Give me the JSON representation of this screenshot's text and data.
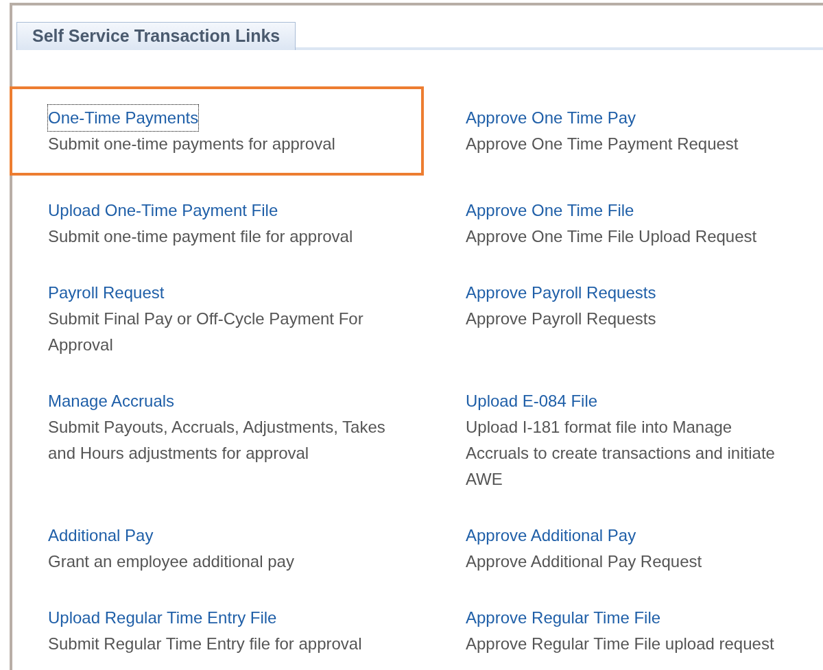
{
  "tab": {
    "label": "Self Service Transaction Links",
    "selected": true
  },
  "rows": [
    {
      "left": {
        "title": "One-Time Payments",
        "description": "Submit one-time payments for approval",
        "highlighted": true,
        "focused": true
      },
      "right": {
        "title": "Approve One Time Pay",
        "description": "Approve One Time Payment Request",
        "highlighted": false,
        "focused": false
      }
    },
    {
      "left": {
        "title": "Upload One-Time Payment File",
        "description": "Submit one-time payment file for approval",
        "highlighted": false,
        "focused": false
      },
      "right": {
        "title": "Approve One Time File",
        "description": "Approve One Time File Upload Request",
        "highlighted": false,
        "focused": false
      }
    },
    {
      "left": {
        "title": "Payroll Request",
        "description": "Submit Final Pay or Off-Cycle Payment For Approval",
        "highlighted": false,
        "focused": false
      },
      "right": {
        "title": "Approve Payroll Requests",
        "description": "Approve Payroll Requests",
        "highlighted": false,
        "focused": false
      }
    },
    {
      "left": {
        "title": "Manage Accruals",
        "description": "Submit Payouts, Accruals, Adjustments, Takes and Hours adjustments for approval",
        "highlighted": false,
        "focused": false
      },
      "right": {
        "title": "Upload E-084 File",
        "description": "Upload I-181 format file into Manage Accruals to create transactions and initiate AWE",
        "highlighted": false,
        "focused": false
      }
    },
    {
      "left": {
        "title": "Additional Pay",
        "description": "Grant an employee additional pay",
        "highlighted": false,
        "focused": false
      },
      "right": {
        "title": "Approve Additional Pay",
        "description": "Approve Additional Pay Request",
        "highlighted": false,
        "focused": false
      }
    },
    {
      "left": {
        "title": "Upload Regular Time Entry File",
        "description": "Submit Regular Time Entry file for approval",
        "highlighted": false,
        "focused": false
      },
      "right": {
        "title": "Approve Regular Time File",
        "description": "Approve Regular Time File upload request",
        "highlighted": false,
        "focused": false
      }
    }
  ]
}
